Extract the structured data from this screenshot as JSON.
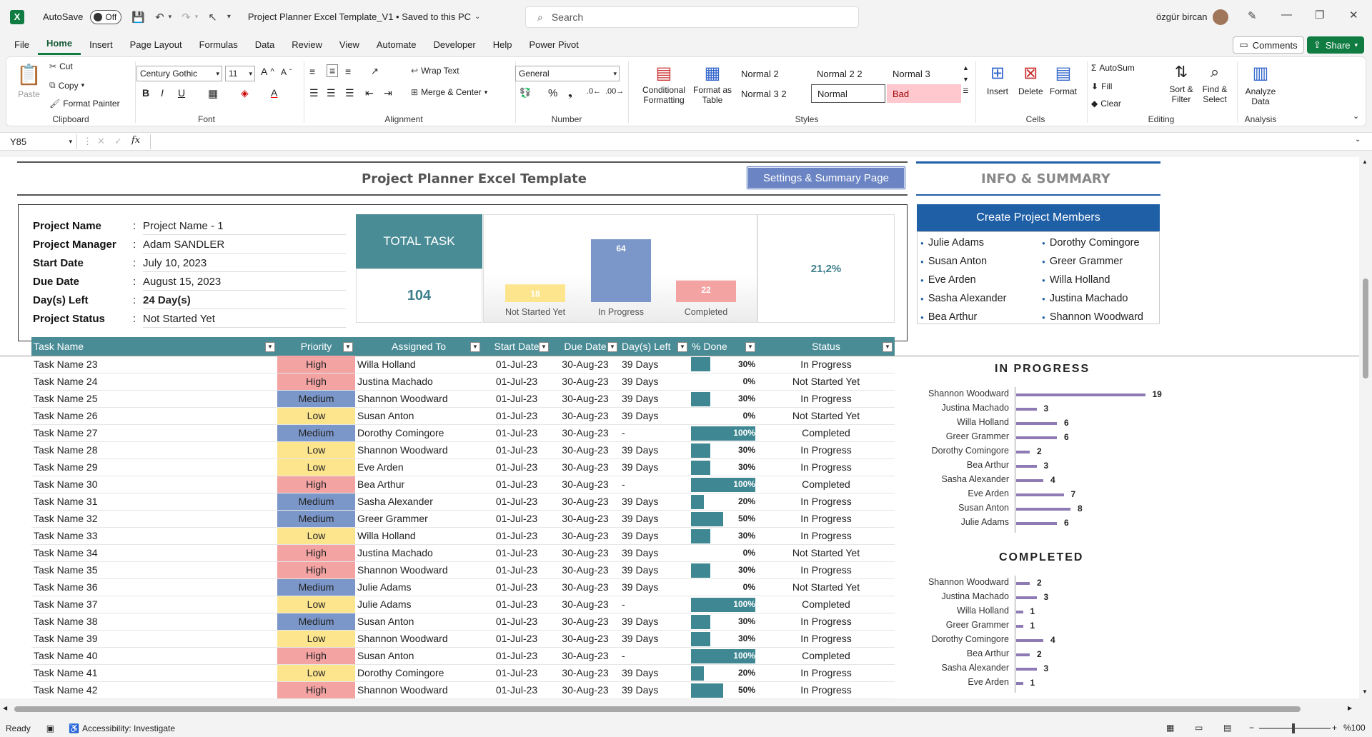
{
  "titlebar": {
    "logo": "X",
    "autosave_label": "AutoSave",
    "autosave_state": "Off",
    "file_title": "Project Planner Excel Template_V1 • Saved to this PC",
    "search_placeholder": "Search",
    "user_name": "özgür bircan"
  },
  "menu": {
    "tabs": [
      "File",
      "Home",
      "Insert",
      "Page Layout",
      "Formulas",
      "Data",
      "Review",
      "View",
      "Automate",
      "Developer",
      "Help",
      "Power Pivot"
    ],
    "active": "Home",
    "comments": "Comments",
    "share": "Share"
  },
  "ribbon": {
    "clipboard": {
      "paste": "Paste",
      "cut": "Cut",
      "copy": "Copy",
      "format_painter": "Format Painter",
      "label": "Clipboard"
    },
    "font": {
      "family": "Century Gothic",
      "size": "11",
      "label": "Font"
    },
    "alignment": {
      "wrap": "Wrap Text",
      "merge": "Merge & Center",
      "label": "Alignment"
    },
    "number": {
      "format": "General",
      "label": "Number"
    },
    "styles": {
      "conditional": "Conditional Formatting",
      "format_table": "Format as Table",
      "cells": [
        "Normal 2",
        "Normal 2 2",
        "Normal 3",
        "Normal 3 2",
        "Normal",
        "Bad"
      ],
      "label": "Styles"
    },
    "cells": {
      "insert": "Insert",
      "delete": "Delete",
      "format": "Format",
      "label": "Cells"
    },
    "editing": {
      "autosum": "AutoSum",
      "fill": "Fill",
      "clear": "Clear",
      "sort": "Sort & Filter",
      "find": "Find & Select",
      "label": "Editing"
    },
    "analysis": {
      "analyze": "Analyze Data",
      "label": "Analysis"
    }
  },
  "formula_bar": {
    "name_box": "Y85",
    "fx": "fx"
  },
  "sheet": {
    "title": "Project Planner Excel Template",
    "settings_button": "Settings & Summary Page",
    "info_title": "INFO & SUMMARY",
    "project_info": [
      {
        "label": "Project Name",
        "value": "Project Name - 1",
        "bold": false
      },
      {
        "label": "Project Manager",
        "value": "Adam SANDLER",
        "bold": false
      },
      {
        "label": "Start Date",
        "value": "July 10, 2023",
        "bold": false
      },
      {
        "label": "Due Date",
        "value": "August 15, 2023",
        "bold": false
      },
      {
        "label": "Day(s) Left",
        "value": "24 Day(s)",
        "bold": true
      },
      {
        "label": "Project Status",
        "value": "Not Started Yet",
        "bold": false
      }
    ],
    "total_task_label": "TOTAL TASK",
    "total_task_value": "104",
    "percent_done": "21,2%",
    "create_members_button": "Create Project Members",
    "members_left": [
      "Julie Adams",
      "Susan Anton",
      "Eve Arden",
      "Sasha Alexander",
      "Bea Arthur"
    ],
    "members_right": [
      "Dorothy Comingore",
      "Greer Grammer",
      "Willa Holland",
      "Justina Machado",
      "Shannon Woodward"
    ]
  },
  "chart_data": [
    {
      "type": "bar",
      "categories": [
        "Not Started Yet",
        "In Progress",
        "Completed"
      ],
      "values": [
        18,
        64,
        22
      ],
      "colors": [
        "#fde58e",
        "#7b96c8",
        "#f4a3a3"
      ]
    },
    {
      "type": "bar",
      "title": "IN PROGRESS",
      "orientation": "horizontal",
      "categories": [
        "Shannon Woodward",
        "Justina Machado",
        "Willa Holland",
        "Greer Grammer",
        "Dorothy Comingore",
        "Bea Arthur",
        "Sasha Alexander",
        "Eve Arden",
        "Susan Anton",
        "Julie Adams"
      ],
      "values": [
        19,
        3,
        6,
        6,
        2,
        3,
        4,
        7,
        8,
        6
      ]
    },
    {
      "type": "bar",
      "title": "COMPLETED",
      "orientation": "horizontal",
      "categories": [
        "Shannon Woodward",
        "Justina Machado",
        "Willa Holland",
        "Greer Grammer",
        "Dorothy Comingore",
        "Bea Arthur",
        "Sasha Alexander",
        "Eve Arden"
      ],
      "values": [
        2,
        3,
        1,
        1,
        4,
        2,
        3,
        1
      ]
    }
  ],
  "table": {
    "headers": [
      "Task Name",
      "Priority",
      "Assigned To",
      "Start Date",
      "Due Date",
      "Day(s) Left",
      "% Done",
      "Status"
    ],
    "rows": [
      [
        "Task Name 23",
        "High",
        "Willa Holland",
        "01-Jul-23",
        "30-Aug-23",
        "39 Days",
        "30%",
        "In Progress"
      ],
      [
        "Task Name 24",
        "High",
        "Justina Machado",
        "01-Jul-23",
        "30-Aug-23",
        "39 Days",
        "0%",
        "Not Started Yet"
      ],
      [
        "Task Name 25",
        "Medium",
        "Shannon Woodward",
        "01-Jul-23",
        "30-Aug-23",
        "39 Days",
        "30%",
        "In Progress"
      ],
      [
        "Task Name 26",
        "Low",
        "Susan Anton",
        "01-Jul-23",
        "30-Aug-23",
        "39 Days",
        "0%",
        "Not Started Yet"
      ],
      [
        "Task Name 27",
        "Medium",
        "Dorothy Comingore",
        "01-Jul-23",
        "30-Aug-23",
        "-",
        "100%",
        "Completed"
      ],
      [
        "Task Name 28",
        "Low",
        "Shannon Woodward",
        "01-Jul-23",
        "30-Aug-23",
        "39 Days",
        "30%",
        "In Progress"
      ],
      [
        "Task Name 29",
        "Low",
        "Eve Arden",
        "01-Jul-23",
        "30-Aug-23",
        "39 Days",
        "30%",
        "In Progress"
      ],
      [
        "Task Name 30",
        "High",
        "Bea Arthur",
        "01-Jul-23",
        "30-Aug-23",
        "-",
        "100%",
        "Completed"
      ],
      [
        "Task Name 31",
        "Medium",
        "Sasha Alexander",
        "01-Jul-23",
        "30-Aug-23",
        "39 Days",
        "20%",
        "In Progress"
      ],
      [
        "Task Name 32",
        "Medium",
        "Greer Grammer",
        "01-Jul-23",
        "30-Aug-23",
        "39 Days",
        "50%",
        "In Progress"
      ],
      [
        "Task Name 33",
        "Low",
        "Willa Holland",
        "01-Jul-23",
        "30-Aug-23",
        "39 Days",
        "30%",
        "In Progress"
      ],
      [
        "Task Name 34",
        "High",
        "Justina Machado",
        "01-Jul-23",
        "30-Aug-23",
        "39 Days",
        "0%",
        "Not Started Yet"
      ],
      [
        "Task Name 35",
        "High",
        "Shannon Woodward",
        "01-Jul-23",
        "30-Aug-23",
        "39 Days",
        "30%",
        "In Progress"
      ],
      [
        "Task Name 36",
        "Medium",
        "Julie Adams",
        "01-Jul-23",
        "30-Aug-23",
        "39 Days",
        "0%",
        "Not Started Yet"
      ],
      [
        "Task Name 37",
        "Low",
        "Julie Adams",
        "01-Jul-23",
        "30-Aug-23",
        "-",
        "100%",
        "Completed"
      ],
      [
        "Task Name 38",
        "Medium",
        "Susan Anton",
        "01-Jul-23",
        "30-Aug-23",
        "39 Days",
        "30%",
        "In Progress"
      ],
      [
        "Task Name 39",
        "Low",
        "Shannon Woodward",
        "01-Jul-23",
        "30-Aug-23",
        "39 Days",
        "30%",
        "In Progress"
      ],
      [
        "Task Name 40",
        "High",
        "Susan Anton",
        "01-Jul-23",
        "30-Aug-23",
        "-",
        "100%",
        "Completed"
      ],
      [
        "Task Name 41",
        "Low",
        "Dorothy Comingore",
        "01-Jul-23",
        "30-Aug-23",
        "39 Days",
        "20%",
        "In Progress"
      ],
      [
        "Task Name 42",
        "High",
        "Shannon Woodward",
        "01-Jul-23",
        "30-Aug-23",
        "39 Days",
        "50%",
        "In Progress"
      ]
    ]
  },
  "status_bar": {
    "ready": "Ready",
    "accessibility": "Accessibility: Investigate",
    "zoom": "%100"
  },
  "colors": {
    "accent": "#107c41",
    "teal": "#4a8c96",
    "blue_header": "#1f5fa6",
    "bar_purple": "#8e7ab5"
  }
}
